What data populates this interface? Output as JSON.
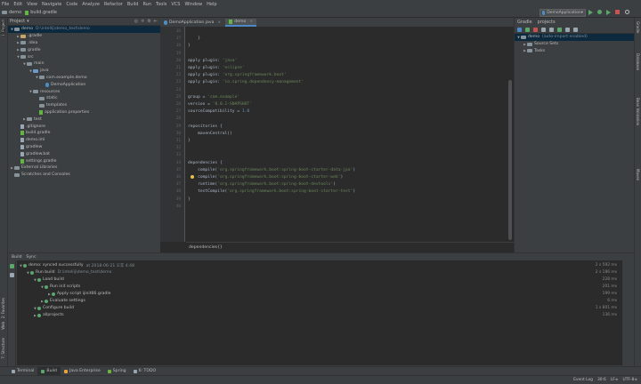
{
  "menu": [
    "File",
    "Edit",
    "View",
    "Navigate",
    "Code",
    "Analyze",
    "Refactor",
    "Build",
    "Run",
    "Tools",
    "VCS",
    "Window",
    "Help"
  ],
  "nav": {
    "project": "demo",
    "file": "build.gradle"
  },
  "run_config": "DemoApplication",
  "project_panel": {
    "title": "Project",
    "tree": [
      {
        "depth": 0,
        "arrow": "▼",
        "icon": "folder",
        "label": "demo",
        "extra": "D:\\intellij\\demo_test\\demo",
        "selected": true
      },
      {
        "depth": 1,
        "arrow": "▶",
        "icon": "folder-orange",
        "label": ".gradle"
      },
      {
        "depth": 1,
        "arrow": "▶",
        "icon": "folder",
        "label": ".idea"
      },
      {
        "depth": 1,
        "arrow": "▶",
        "icon": "folder",
        "label": "gradle"
      },
      {
        "depth": 1,
        "arrow": "▼",
        "icon": "folder",
        "label": "src"
      },
      {
        "depth": 2,
        "arrow": "▼",
        "icon": "folder",
        "label": "main"
      },
      {
        "depth": 3,
        "arrow": "▼",
        "icon": "folder-blue",
        "label": "java"
      },
      {
        "depth": 4,
        "arrow": "▼",
        "icon": "folder",
        "label": "com.example.demo"
      },
      {
        "depth": 5,
        "arrow": "",
        "icon": "java",
        "label": "DemoApplication"
      },
      {
        "depth": 3,
        "arrow": "▼",
        "icon": "folder",
        "label": "resources"
      },
      {
        "depth": 4,
        "arrow": "",
        "icon": "folder",
        "label": "static"
      },
      {
        "depth": 4,
        "arrow": "",
        "icon": "folder",
        "label": "templates"
      },
      {
        "depth": 4,
        "arrow": "",
        "icon": "file-green",
        "label": "application.properties"
      },
      {
        "depth": 2,
        "arrow": "▶",
        "icon": "folder",
        "label": "test"
      },
      {
        "depth": 1,
        "arrow": "",
        "icon": "file",
        "label": ".gitignore"
      },
      {
        "depth": 1,
        "arrow": "",
        "icon": "file-green",
        "label": "build.gradle"
      },
      {
        "depth": 1,
        "arrow": "",
        "icon": "file",
        "label": "demo.iml"
      },
      {
        "depth": 1,
        "arrow": "",
        "icon": "file",
        "label": "gradlew"
      },
      {
        "depth": 1,
        "arrow": "",
        "icon": "file",
        "label": "gradlew.bat"
      },
      {
        "depth": 1,
        "arrow": "",
        "icon": "file-green",
        "label": "settings.gradle"
      },
      {
        "depth": 0,
        "arrow": "▶",
        "icon": "folder",
        "label": "External Libraries"
      },
      {
        "depth": 0,
        "arrow": "",
        "icon": "folder",
        "label": "Scratches and Consoles"
      }
    ]
  },
  "editor_tabs": [
    {
      "label": "DemoApplication.java",
      "active": false
    },
    {
      "label": "demo",
      "active": true
    }
  ],
  "editor": {
    "lines": [
      {
        "n": "16",
        "t": ""
      },
      {
        "n": "17",
        "t": "    }"
      },
      {
        "n": "18",
        "t": "}"
      },
      {
        "n": "19",
        "t": ""
      },
      {
        "n": "20",
        "t": "apply plugin: 'java'"
      },
      {
        "n": "21",
        "t": "apply plugin: 'eclipse'"
      },
      {
        "n": "22",
        "t": "apply plugin: 'org.springframework.boot'"
      },
      {
        "n": "23",
        "t": "apply plugin: 'io.spring.dependency-management'"
      },
      {
        "n": "24",
        "t": ""
      },
      {
        "n": "25",
        "t": "group = 'com.example'"
      },
      {
        "n": "26",
        "t": "version = '0.0.1-SNAPSHOT'"
      },
      {
        "n": "27",
        "t": "sourceCompatibility = 1.8"
      },
      {
        "n": "28",
        "t": ""
      },
      {
        "n": "29",
        "t": "repositories {"
      },
      {
        "n": "30",
        "t": "    mavenCentral()"
      },
      {
        "n": "31",
        "t": "}"
      },
      {
        "n": "32",
        "t": ""
      },
      {
        "n": "33",
        "t": ""
      },
      {
        "n": "34",
        "t": "dependencies {"
      },
      {
        "n": "35",
        "t": "    compile('org.springframework.boot:spring-boot-starter-data-jpa')"
      },
      {
        "n": "36",
        "t": "    compile('org.springframework.boot:spring-boot-starter-web')"
      },
      {
        "n": "37",
        "t": "    runtime('org.springframework.boot:spring-boot-devtools')"
      },
      {
        "n": "38",
        "t": "    testCompile('org.springframework.boot:spring-boot-starter-test')"
      },
      {
        "n": "39",
        "t": "}"
      },
      {
        "n": "40",
        "t": ""
      }
    ],
    "breadcrumb": "dependencies{}"
  },
  "gradle_panel": {
    "title": "Gradle",
    "subtitle": "projects",
    "tree": [
      {
        "depth": 0,
        "arrow": "▼",
        "label": "demo",
        "extra": "(auto-import enabled)"
      },
      {
        "depth": 1,
        "arrow": "▶",
        "label": "Source Sets"
      },
      {
        "depth": 1,
        "arrow": "▶",
        "label": "Tasks"
      }
    ]
  },
  "build_panel": {
    "tabs": [
      "Build",
      "Sync"
    ],
    "rows": [
      {
        "depth": 0,
        "label": "demo: synced successfully",
        "extra": "at 2018-06-21 오후 4:48",
        "dur": "2 s 592 ms"
      },
      {
        "depth": 1,
        "label": "Run build",
        "extra": "D:\\intellij\\demo_test\\demo",
        "dur": "2 s 186 ms"
      },
      {
        "depth": 2,
        "label": "Load build",
        "extra": "",
        "dur": "228 ms"
      },
      {
        "depth": 3,
        "label": "Run init scripts",
        "extra": "",
        "dur": "201 ms"
      },
      {
        "depth": 4,
        "label": "Apply script ijinit66.gradle",
        "extra": "",
        "dur": "199 ms"
      },
      {
        "depth": 3,
        "label": "Evaluate settings",
        "extra": "",
        "dur": "6 ms"
      },
      {
        "depth": 2,
        "label": "Configure build",
        "extra": "",
        "dur": "1 s 801 ms"
      },
      {
        "depth": 2,
        "label": "allprojects",
        "extra": "",
        "dur": "136 ms"
      }
    ]
  },
  "bottom_tabs": [
    "Terminal",
    "Build",
    "Java Enterprise",
    "Spring",
    "6: TODO"
  ],
  "status": {
    "event_log": "Event Log",
    "position": "30:6",
    "line_sep": "LF≑",
    "encoding": "UTF-8≑"
  },
  "left_strip": [
    "1: Project",
    "7: Structure",
    "2: Favorites",
    "Web"
  ],
  "right_strip": [
    "Gradle",
    "Database",
    "Bean Validation",
    "Maven"
  ]
}
